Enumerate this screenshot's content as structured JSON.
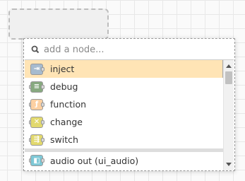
{
  "search": {
    "placeholder": "add a node..."
  },
  "nodes": [
    {
      "label": "inject",
      "color": "#a6bbcf",
      "symbol": "⇥",
      "selected": true,
      "ports": "right"
    },
    {
      "label": "debug",
      "color": "#87a980",
      "symbol": "≡",
      "selected": false,
      "ports": "left"
    },
    {
      "label": "function",
      "color": "#fdd0a2",
      "symbol": "ƒ",
      "selected": false,
      "ports": "both"
    },
    {
      "label": "change",
      "color": "#e2d96e",
      "symbol": "✕",
      "selected": false,
      "ports": "both"
    },
    {
      "label": "switch",
      "color": "#e2d96e",
      "symbol": "⇶",
      "selected": false,
      "ports": "both"
    },
    {
      "label": "audio out (ui_audio)",
      "color": "#7ec8d6",
      "symbol": "◧",
      "selected": false,
      "ports": "left",
      "group_start": true
    },
    {
      "label": "",
      "color": "#c6d66f",
      "symbol": "",
      "selected": false,
      "ports": "left"
    }
  ],
  "icons": {
    "search": "search-icon",
    "scroll_up": "chevron-up-icon",
    "scroll_down": "chevron-down-icon"
  }
}
